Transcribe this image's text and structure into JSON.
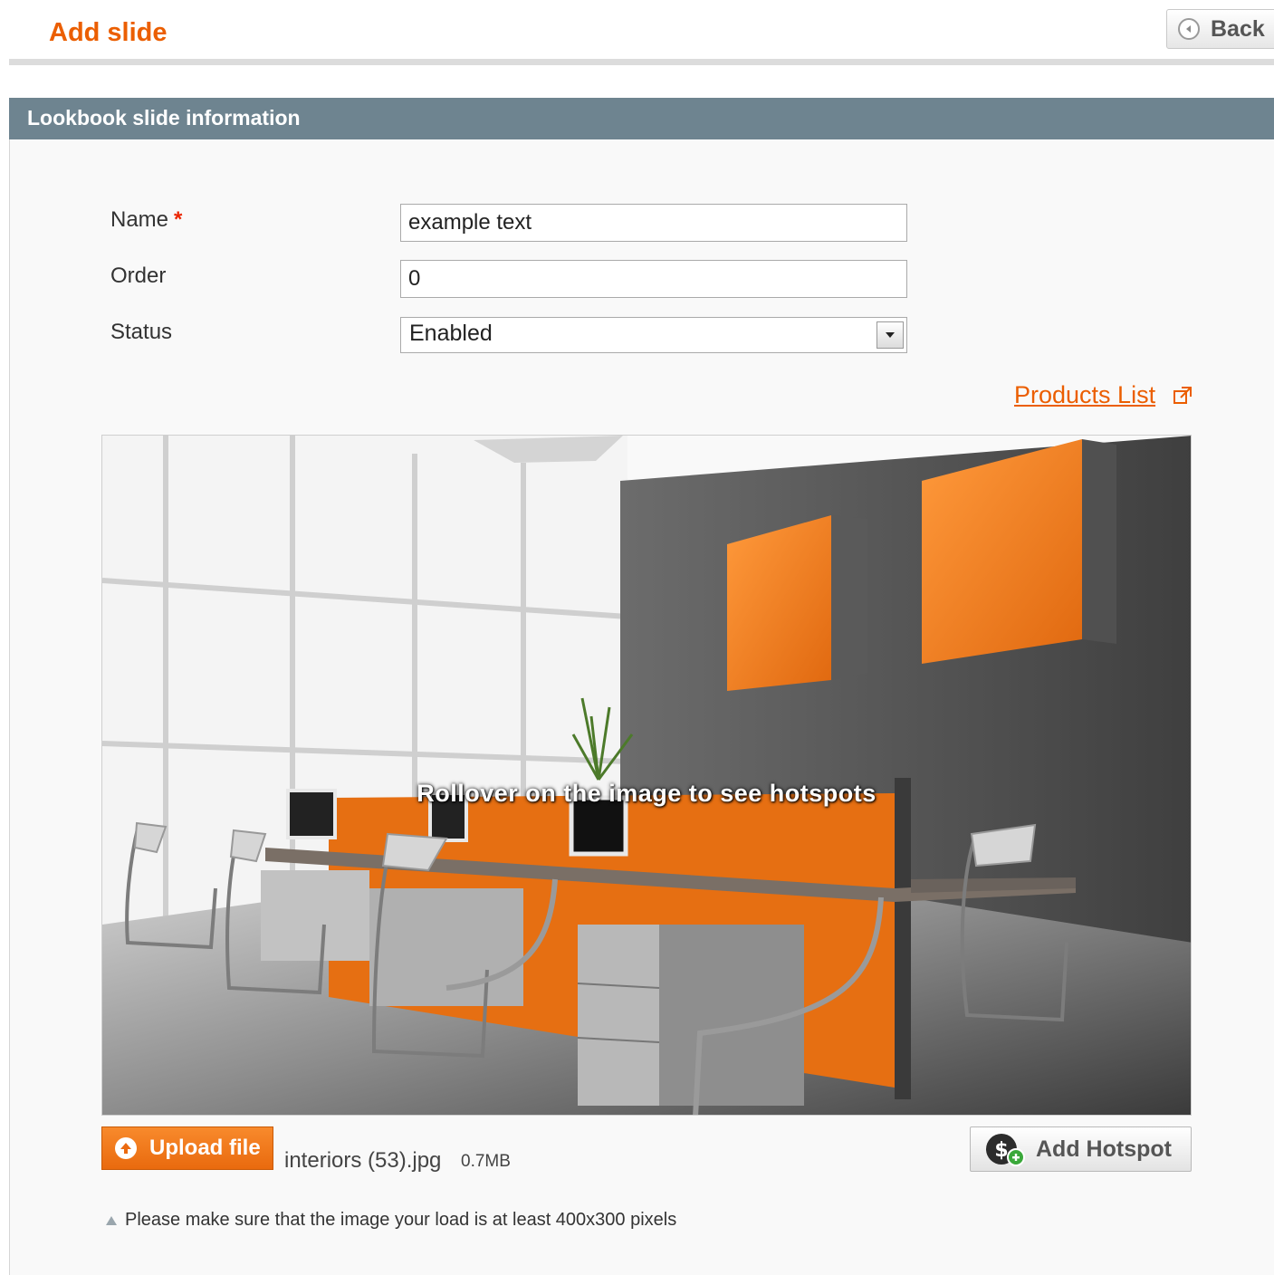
{
  "header": {
    "title": "Add slide",
    "back_label": "Back"
  },
  "fieldset": {
    "title": "Lookbook slide information"
  },
  "form": {
    "name_label": "Name",
    "name_required": "*",
    "name_value": "example text",
    "order_label": "Order",
    "order_value": "0",
    "status_label": "Status",
    "status_value": "Enabled"
  },
  "links": {
    "products_list": "Products List"
  },
  "image": {
    "rollover_text": "Rollover on the image to see hotspots"
  },
  "upload": {
    "button_label": "Upload file",
    "file_name": "interiors (53).jpg",
    "file_size": "0.7MB"
  },
  "hotspot": {
    "button_label": "Add Hotspot"
  },
  "note": {
    "text": "Please make sure that the image your load is at least 400x300 pixels"
  },
  "colors": {
    "accent": "#eb5e00",
    "section_header": "#6e8490"
  },
  "icons": {
    "back": "back-arrow-circle-icon",
    "select": "chevron-down-icon",
    "external": "external-link-icon",
    "upload": "upload-arrow-icon",
    "hotspot": "dollar-plus-icon",
    "note": "triangle-icon"
  }
}
